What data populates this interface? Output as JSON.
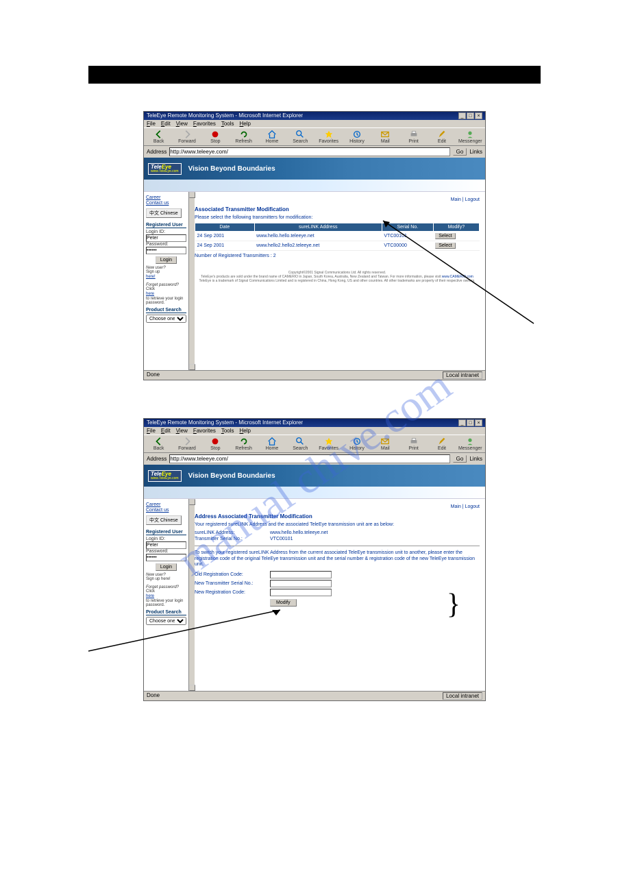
{
  "titlebar": "TeleEye Remote Monitoring System - Microsoft Internet Explorer",
  "menu": {
    "file": "File",
    "edit": "Edit",
    "view": "View",
    "favorites": "Favorites",
    "tools": "Tools",
    "help": "Help"
  },
  "toolbar": {
    "back": "Back",
    "forward": "Forward",
    "stop": "Stop",
    "refresh": "Refresh",
    "home": "Home",
    "search": "Search",
    "favorites": "Favorites",
    "history": "History",
    "mail": "Mail",
    "print": "Print",
    "editbtn": "Edit",
    "messenger": "Messenger"
  },
  "addr": {
    "label": "Address",
    "url": "http://www.teleeye.com/",
    "go": "Go",
    "links": "Links"
  },
  "brand": {
    "tele": "Tele",
    "eye": "Eye",
    "sub": "www.TeleEye.com",
    "slogan": "Vision Beyond Boundaries"
  },
  "side": {
    "career": "Career",
    "contact": "Contact us",
    "chinese": "中文 Chinese",
    "reguser": "Registered User",
    "loginid": "Login ID:",
    "loginval": "Peter",
    "password": "Password:",
    "pwval": "******",
    "login": "Login",
    "newuser": "New user?",
    "signup": "Sign up ",
    "here": "here!",
    "signup2": "Sign up here!",
    "forgot": "Forget password?",
    "click": "Click ",
    "here2": "here",
    "rest": " to retrieve your login password.",
    "prodsearch": "Product Search",
    "choose": "Choose one"
  },
  "s1": {
    "toplinks": {
      "main": "Main",
      "logout": "Logout"
    },
    "h": "Associated Transmitter Modification",
    "intro": "Please select the following transmitters for modification:",
    "th": {
      "date": "Date",
      "addr": "sureLINK Address",
      "serial": "Serial No.",
      "mod": "Modify?"
    },
    "rows": [
      {
        "date": "24 Sep 2001",
        "addr": "www.hello.hello.teleeye.net",
        "serial": "VTC00101",
        "btn": "Select"
      },
      {
        "date": "24 Sep 2001",
        "addr": "www.hello2.hello2.teleeye.net",
        "serial": "VTC00000",
        "btn": "Select"
      }
    ],
    "count": "Number of Registered Transmitters : 2"
  },
  "foot": {
    "l1": "Copyright©2001 Signal Communications Ltd. All rights reserved.",
    "l2a": "TeleEye's products are sold under the brand name of CAMERIO in Japan, South Korea, Australia, New Zealand and Taiwan. For more information, please visit ",
    "l2link": "www.CAMERIO.com",
    "l3": "TeleEye is a trademark of Signal Communications Limited and is registered in China, Hong Kong, US and other countries. All other trademarks are property of their respective owners."
  },
  "status": {
    "done": "Done",
    "zone": "Local intranet"
  },
  "s2": {
    "toplinks": {
      "main": "Main",
      "logout": "Logout"
    },
    "h": "Address Associated Transmitter Modification",
    "intro": "Your registered sureLINK Address and the associated TeleEye transmission unit are as below:",
    "f1l": "sureLINK Address:",
    "f1v": "www.hello.hello.teleeye.net",
    "f2l": "Transmitter Serial No.:",
    "f2v": "VTC00101",
    "desc": "To switch your registered sureLINK Address from the current associated TeleEye transmission unit to another, please enter the registration code of the original TeleEye transmission unit and the serial number & registration code of the new TeleEye transmission unit.",
    "f3": "Old Registration Code:",
    "f4": "New Transmitter Serial No.:",
    "f5": "New Registration Code:",
    "mod": "Modify"
  }
}
